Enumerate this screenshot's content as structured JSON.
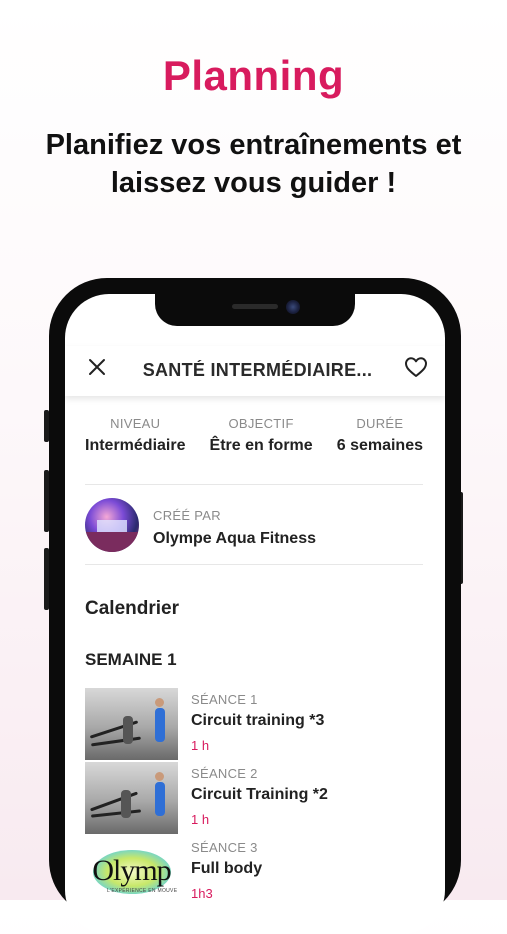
{
  "promo": {
    "headline": "Planning",
    "subtitle_line1": "Planifiez vos entraînements et",
    "subtitle_line2": "laissez vous guider !"
  },
  "app": {
    "nav": {
      "title": "SANTÉ INTERMÉDIAIRE...",
      "close_icon": "close-icon",
      "favorite_icon": "heart-outline-icon"
    },
    "stats": [
      {
        "label": "NIVEAU",
        "value": "Intermédiaire"
      },
      {
        "label": "OBJECTIF",
        "value": "Être en forme"
      },
      {
        "label": "DURÉE",
        "value": "6 semaines"
      }
    ],
    "creator": {
      "label": "CRÉÉ PAR",
      "name": "Olympe Aqua Fitness"
    },
    "calendar": {
      "title": "Calendrier",
      "week_title": "SEMAINE 1",
      "sessions": [
        {
          "label": "SÉANCE 1",
          "name": "Circuit training *3",
          "duration": "1 h"
        },
        {
          "label": "SÉANCE 2",
          "name": "Circuit Training *2",
          "duration": "1 h"
        },
        {
          "label": "SÉANCE 3",
          "name": "Full body",
          "duration": "1h3"
        }
      ],
      "logo_brand": "Olymp",
      "logo_tagline": "L'EXPÉRIENCE EN MOUVE"
    }
  },
  "colors": {
    "accent": "#d81b5e",
    "text": "#222222",
    "muted": "#8a8a8a"
  }
}
